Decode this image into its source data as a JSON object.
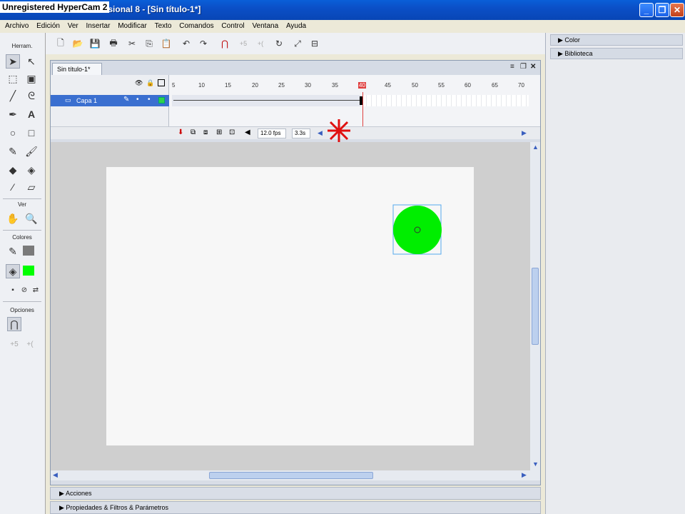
{
  "window": {
    "title": "Macromedia Flash Professional 8 - [Sin título-1*]",
    "watermark": "Unregistered HyperCam 2",
    "controls": [
      "minimize",
      "maximize",
      "close"
    ]
  },
  "menu": [
    "Archivo",
    "Edición",
    "Ver",
    "Insertar",
    "Modificar",
    "Texto",
    "Comandos",
    "Control",
    "Ventana",
    "Ayuda"
  ],
  "tools": {
    "header": "Herram.",
    "view_header": "Ver",
    "colors_header": "Colores",
    "options_header": "Opciones",
    "fill_color": "#00ff00"
  },
  "document": {
    "tab": "Sin título-1*",
    "layer_name": "Capa 1",
    "frame_rate": "12.0 fps",
    "time": "3.3s",
    "ruler_ticks": [
      "5",
      "10",
      "15",
      "20",
      "25",
      "30",
      "35",
      "40",
      "45",
      "50",
      "55",
      "60",
      "65",
      "70"
    ],
    "current_frame": 40
  },
  "stage": {
    "circle_color": "#00ee00",
    "background": "#f7f7f7"
  },
  "panels": {
    "bottom": [
      "Acciones",
      "Propiedades & Filtros & Parámetros"
    ],
    "right": [
      "Color",
      "Biblioteca"
    ]
  }
}
